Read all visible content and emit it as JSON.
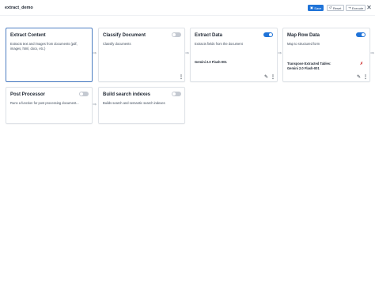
{
  "page": {
    "title": "extract_demo"
  },
  "toolbar": {
    "save_label": "Save",
    "reset_label": "Reset",
    "execute_label": "Execute"
  },
  "nodes": [
    {
      "title": "Extract Content",
      "description": "Extracts text and images from documents (pdf, images, html, docx, etc.)",
      "enabled": null
    },
    {
      "title": "Classify Document",
      "description": "Classify documents",
      "enabled": false
    },
    {
      "title": "Extract Data",
      "description": "Extracts fields from the document",
      "model": "Gemini 2.0 Flash-001",
      "enabled": true
    },
    {
      "title": "Map Row Data",
      "description": "Map to structured form",
      "model_label": "Transpose Extracted Tables:",
      "model": "Gemini 2.0 Flash-001",
      "enabled": true
    },
    {
      "title": "Post Processor",
      "description": "Runs a function for post processing document...",
      "enabled": false
    },
    {
      "title": "Build search indexes",
      "description": "Builds search and semantic search indexes",
      "enabled": false
    }
  ],
  "colors": {
    "accent": "#1f73d8",
    "active_border": "#4f80c4",
    "error": "#d23c3c"
  },
  "icons": [
    "save-icon",
    "reset-icon",
    "execute-icon",
    "close-icon",
    "toggle",
    "kebab-menu-icon",
    "pencil-icon",
    "arrow-right-icon",
    "error-x-icon"
  ]
}
